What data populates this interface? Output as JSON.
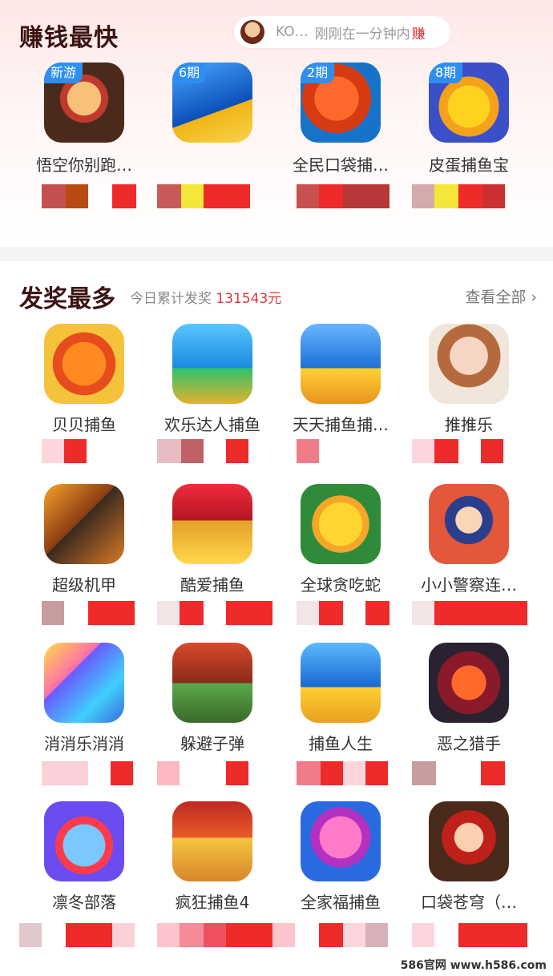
{
  "top": {
    "title": "赚钱最快",
    "ticker": {
      "user": "KO…",
      "message": "刚刚在一分钟内",
      "money": "赚"
    },
    "apps": [
      {
        "name": "悟空你别跑…",
        "badge": "新游",
        "icon": "wukong-game-icon"
      },
      {
        "name": "",
        "badge": "6期",
        "icon": "shark-fishing-icon"
      },
      {
        "name": "全民口袋捕…",
        "badge": "2期",
        "icon": "red-fish-icon"
      },
      {
        "name": "皮蛋捕鱼宝",
        "badge": "8期",
        "icon": "gold-fish-treasure-icon"
      }
    ]
  },
  "award": {
    "title": "发奖最多",
    "subtitle_prefix": "今日累计发奖",
    "amount": "131543元",
    "see_all": "查看全部 ›",
    "apps": [
      {
        "name": "贝贝捕鱼",
        "icon": "clownfish-icon"
      },
      {
        "name": "欢乐达人捕鱼",
        "icon": "shark-cannon-icon"
      },
      {
        "name": "天天捕鱼捕…",
        "icon": "shark-vip-icon"
      },
      {
        "name": "推推乐",
        "icon": "girl-portrait-icon"
      },
      {
        "name": "超级机甲",
        "icon": "mech-ship-icon"
      },
      {
        "name": "酷爱捕鱼",
        "icon": "shark-gold-icon"
      },
      {
        "name": "全球贪吃蛇",
        "icon": "yellow-pet-icon"
      },
      {
        "name": "小小警察连…",
        "icon": "police-boy-icon"
      },
      {
        "name": "消消乐消消",
        "icon": "block-puzzle-icon"
      },
      {
        "name": "躲避子弹",
        "icon": "tank-icon"
      },
      {
        "name": "捕鱼人生",
        "icon": "shark-treasure-icon"
      },
      {
        "name": "恶之猎手",
        "icon": "dragon-icon"
      },
      {
        "name": "凛冬部落",
        "icon": "fruit-cat-icon"
      },
      {
        "name": "疯狂捕鱼4",
        "icon": "shark-boat-icon"
      },
      {
        "name": "全家福捕鱼",
        "icon": "pink-fish-icon"
      },
      {
        "name": "口袋苍穹（…",
        "icon": "hero-boy-icon"
      }
    ]
  },
  "watermark": "586官网 www.h586.com",
  "colors": {
    "accent": "#d8393a",
    "title": "#3c1412",
    "badge": "#2e8ff0"
  }
}
